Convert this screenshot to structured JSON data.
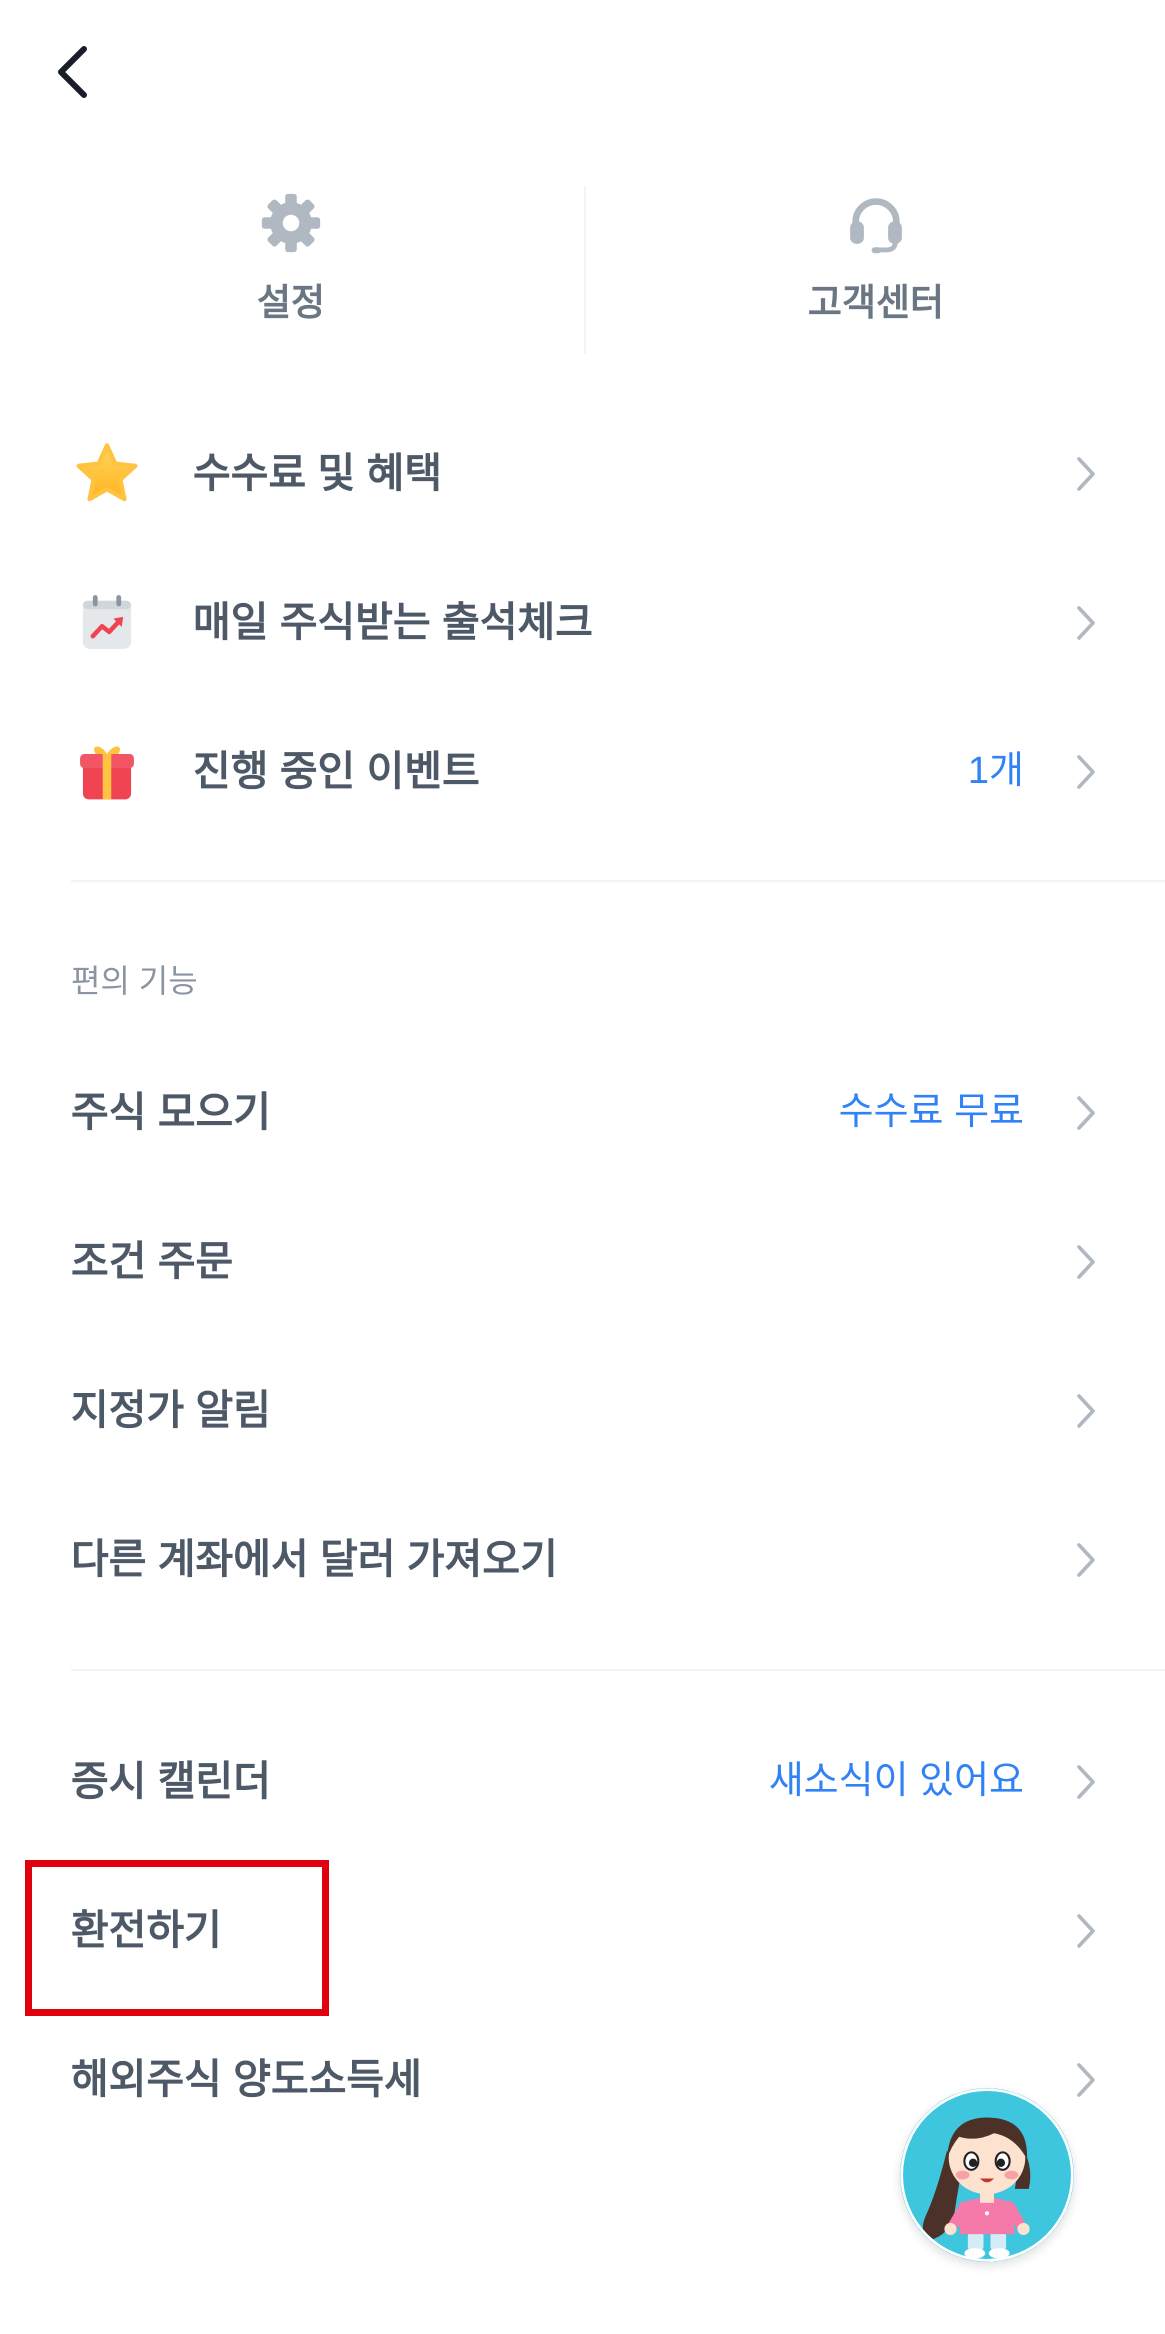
{
  "header": {
    "back_icon": "chevron-left-icon"
  },
  "shortcuts": [
    {
      "label": "설정",
      "icon": "gear-icon"
    },
    {
      "label": "고객센터",
      "icon": "headset-icon"
    }
  ],
  "benefits": {
    "items": [
      {
        "label": "수수료 및 혜택",
        "icon": "star-icon"
      },
      {
        "label": "매일 주식받는 출석체크",
        "icon": "calendar-chart-icon"
      },
      {
        "label": "진행 중인 이벤트",
        "icon": "gift-icon",
        "value": "1개"
      }
    ]
  },
  "convenience": {
    "title": "편의 기능",
    "items": [
      {
        "label": "주식 모으기",
        "value": "수수료 무료"
      },
      {
        "label": "조건 주문"
      },
      {
        "label": "지정가 알림"
      },
      {
        "label": "다른 계좌에서 달러 가져오기"
      }
    ]
  },
  "more": {
    "items": [
      {
        "label": "증시 캘린더",
        "value": "새소식이 있어요"
      },
      {
        "label": "환전하기",
        "highlighted": true
      },
      {
        "label": "해외주식 양도소득세"
      }
    ]
  },
  "floating_button": {
    "icon": "character-avatar-icon"
  },
  "row_chevron_icon": "chevron-right-icon",
  "colors": {
    "text": "#4e5968",
    "blue": "#3182f6",
    "sub": "#8b95a1",
    "tile-label": "#6b7684",
    "div": "#f2f4f6",
    "hl": "#e1000f",
    "bg": "#ffffff"
  }
}
